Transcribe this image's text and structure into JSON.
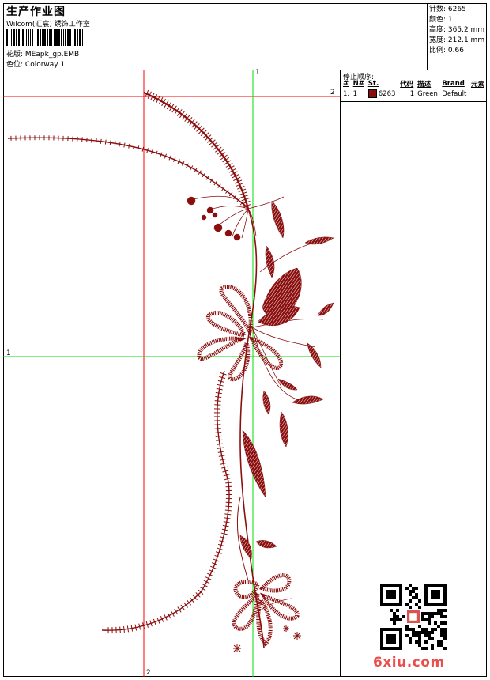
{
  "header": {
    "title": "生产作业图",
    "subtitle": "Wilcom(汇宸) 绣饰工作室",
    "design_label": "花版:",
    "design_value": "MEapk_gp.EMB",
    "colorway_label": "色位:",
    "colorway_value": "Colorway 1"
  },
  "stats": {
    "stitches": {
      "label": "针数:",
      "value": "6265"
    },
    "colors": {
      "label": "颜色:",
      "value": "1"
    },
    "height": {
      "label": "高度:",
      "value": "365.2 mm"
    },
    "width": {
      "label": "宽度:",
      "value": "212.1 mm"
    },
    "scale": {
      "label": "比例:",
      "value": "0.66"
    }
  },
  "stop_sequence": {
    "title": "停止顺序:",
    "headers": [
      "#",
      "N#",
      "St.",
      "代码",
      "描述",
      "Brand",
      "元素"
    ],
    "rows": [
      {
        "num": "1.",
        "needle": "1",
        "stitches": "6263",
        "code": "1",
        "desc": "Green",
        "brand": "Default",
        "color": "#8b0e0e"
      }
    ]
  },
  "crosshair_labels": {
    "top_green": "1",
    "top_red": "2",
    "left_green": "1",
    "bottom_red": "2"
  },
  "colors": {
    "thread": "#8b0e0e",
    "guide_red": "#ff0000",
    "guide_green": "#00dd00",
    "watermark": "#e8504d"
  },
  "watermark": {
    "text": "6xiu.com"
  }
}
